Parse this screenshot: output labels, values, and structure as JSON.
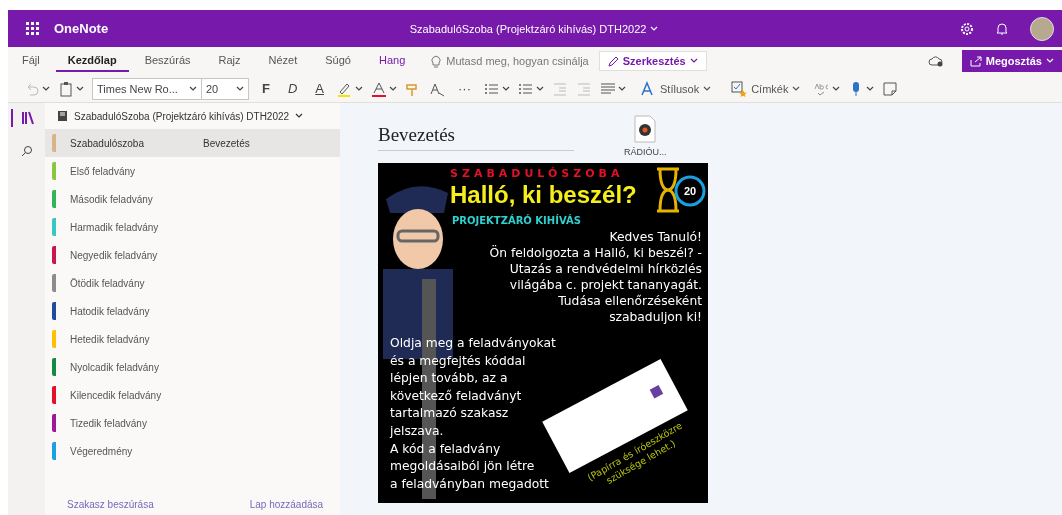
{
  "app": {
    "name": "OneNote",
    "title": "SzabadulóSzoba (Projektzáró kihívás) DTH2022"
  },
  "ribbon_tabs": [
    {
      "label": "Fájl",
      "selected": false,
      "accent": false
    },
    {
      "label": "Kezdőlap",
      "selected": true,
      "accent": false
    },
    {
      "label": "Beszúrás",
      "selected": false,
      "accent": false
    },
    {
      "label": "Rajz",
      "selected": false,
      "accent": false
    },
    {
      "label": "Nézet",
      "selected": false,
      "accent": false
    },
    {
      "label": "Súgó",
      "selected": false,
      "accent": false
    },
    {
      "label": "Hang",
      "selected": false,
      "accent": true
    }
  ],
  "tell_me": "Mutasd meg, hogyan csinálja",
  "mode_button": "Szerkesztés",
  "share_button": "Megosztás",
  "toolbar": {
    "font": "Times New Ro...",
    "size": "20",
    "bold": "F",
    "italic": "D",
    "underline": "A",
    "more": "···",
    "styles": "Stílusok",
    "tags": "Címkék"
  },
  "notebook": {
    "title": "SzabadulóSzoba (Projektzáró kihívás) DTH2022",
    "sections": [
      {
        "label": "Szabadulószoba",
        "color": "#d9b38c",
        "selected": true
      },
      {
        "label": "Első feladvány",
        "color": "#8cc63f",
        "selected": false
      },
      {
        "label": "Második feladvány",
        "color": "#33b35a",
        "selected": false
      },
      {
        "label": "Harmadik feladvány",
        "color": "#3cc6c1",
        "selected": false
      },
      {
        "label": "Negyedik feladvány",
        "color": "#c8174f",
        "selected": false
      },
      {
        "label": "Ötödik feladvány",
        "color": "#8c8c8c",
        "selected": false
      },
      {
        "label": "Hatodik feladvány",
        "color": "#1c4e9a",
        "selected": false
      },
      {
        "label": "Hetedik feladvány",
        "color": "#ffc000",
        "selected": false
      },
      {
        "label": "Nyolcadik feladvány",
        "color": "#168a44",
        "selected": false
      },
      {
        "label": "Kilencedik feladvány",
        "color": "#e3102a",
        "selected": false
      },
      {
        "label": "Tizedik feladvány",
        "color": "#a0169a",
        "selected": false
      },
      {
        "label": "Végeredmény",
        "color": "#1aa0e0",
        "selected": false
      }
    ],
    "pages": [
      {
        "label": "Bevezetés",
        "selected": true
      }
    ],
    "add_section": "Szakasz beszúrása",
    "add_page": "Lap hozzáadása"
  },
  "page": {
    "title": "Bevezetés",
    "attachment": "RÁDIÓU...",
    "poster": {
      "kicker": "SZABADULÓSZOBA",
      "headline": "Halló, ki beszél?",
      "subtitle": "PROJEKTZÁRÓ KIHÍVÁS",
      "timer": "20",
      "intro": [
        "Kedves Tanuló!",
        "Ön feldolgozta a Halló, ki beszél? -",
        "Utazás a rendvédelmi hírközlés",
        "világába c. projekt tananyagát.",
        "Tudása ellenőrzéseként",
        "szabaduljon ki!"
      ],
      "body": [
        "Oldja meg a feladványokat",
        "és a megfejtés kóddal",
        "lépjen tovább, az a",
        "következő feladványt",
        "tartalmazó szakasz",
        "jelszava.",
        "A kód a feladvány",
        "megoldásaiból jön létre",
        "a feladványban megadott"
      ],
      "note": "(Papírra és íróeszközre szüksége lehet.)"
    }
  }
}
